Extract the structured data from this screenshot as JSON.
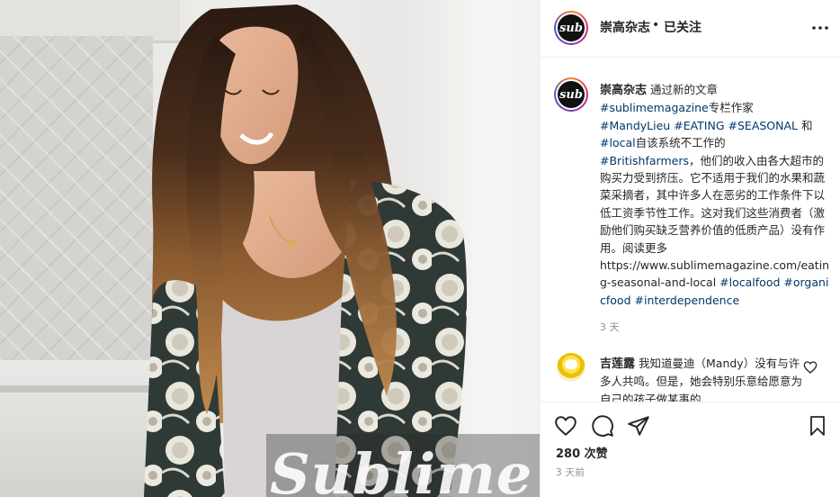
{
  "photo": {
    "alt_icon": "photo",
    "wordmark": "Sublime"
  },
  "header": {
    "username": "崇高杂志",
    "separator": "•",
    "follow_status": "已关注",
    "avatar_text": "sub"
  },
  "caption": {
    "username": "崇高杂志",
    "intro": "通过新的文章",
    "tag_magazine": "#sublimemagazine",
    "text_1": "专栏作家",
    "tag_mandy": "#MandyLieu",
    "tag_eating": "#EATING",
    "tag_seasonal": "#SEASONAL",
    "text_and": "和",
    "tag_local": "#local",
    "text_2": "自该系统不工作的",
    "tag_british": "#Britishfarmers",
    "text_3": "，他们的收入由各大超市的购买力受到挤压。它不适用于我们的水果和蔬菜采摘者，其中许多人在恶劣的工作条件下以低工资季节性工作。这对我们这些消费者（激励他们购买缺乏营养价值的低质产品）没有作用。阅读更多",
    "link": "https://www.sublimemagazine.com/eating-seasonal-and-local",
    "tag_localfood": "#localfood",
    "tag_organic": "#organicfood",
    "tag_interdep": "#interdependence",
    "time": "3 天"
  },
  "comment": {
    "username": "吉莲露",
    "text": "我知道曼迪（Mandy）没有与许多人共鸣。但是，她会特别乐意给愿意为自己的孩子做某事的"
  },
  "actions": {
    "likes": "280 次赞",
    "time": "3 天前"
  },
  "colors": {
    "hashtag": "#00376b",
    "muted": "#8e8e8e",
    "text": "#262626"
  }
}
